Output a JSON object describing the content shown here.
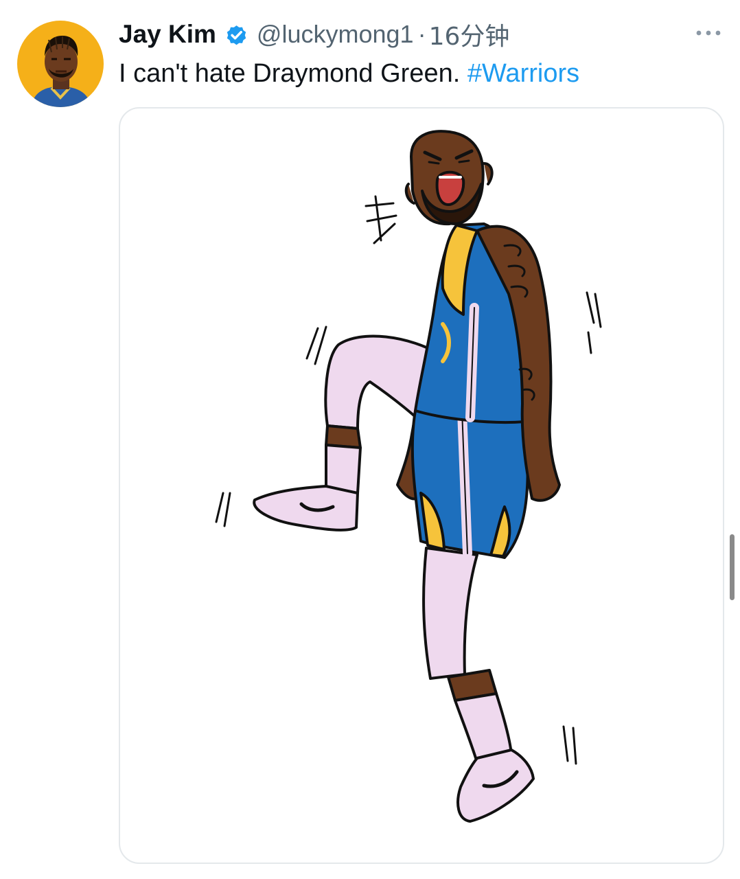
{
  "tweet": {
    "author": {
      "display_name": "Jay Kim",
      "verified": true,
      "handle": "@luckymong1",
      "avatar_icon": "portrait-avatar"
    },
    "separator": "·",
    "timestamp": "16分钟",
    "text": "I can't hate Draymond Green. ",
    "hashtag": "#Warriors",
    "more_icon": "more-horizontal-icon",
    "media": {
      "kind": "illustration"
    }
  },
  "colors": {
    "text_primary": "#0f1419",
    "text_secondary": "#536471",
    "link": "#1d9bf0",
    "verified_badge": "#1d9bf0",
    "avatar_bg": "#f5b019",
    "jersey_blue": "#1d6fbd",
    "jersey_gold": "#f6c33b",
    "skin": "#6b3b1e",
    "sleeve_pink": "#efd9ee"
  }
}
